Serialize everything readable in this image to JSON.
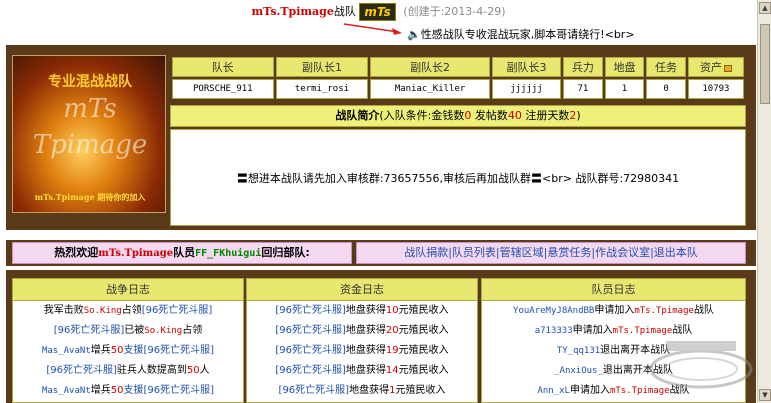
{
  "header": {
    "team_name": "mTs.Tpimage",
    "team_suffix": "战队",
    "logo_text": "mTs",
    "created": "(创建于:2013-4-29)"
  },
  "tagline": {
    "text": "性感战队专收混战玩家,脚本哥请绕行!<br>"
  },
  "crest": {
    "line1": "专业混战战队",
    "line2": "mTs",
    "line3": "Tpimage",
    "line4": "mTs.Tpimage 期待你的加入"
  },
  "officers": {
    "headers": [
      "队长",
      "副队长1",
      "副队长2",
      "副队长3",
      "兵力",
      "地盘",
      "任务",
      "资产"
    ],
    "values": [
      "PORSCHE_911",
      "termi_rosi",
      "Maniac_Killer",
      "jjjjjj",
      "71",
      "1",
      "0",
      "10793"
    ]
  },
  "intro": {
    "title": "战队简介",
    "cond_prefix": "(入队条件:金钱数",
    "gold": "0",
    "posts_label": " 发帖数",
    "posts": "40",
    "days_label": " 注册天数",
    "days": "2",
    "cond_suffix": ")",
    "body": "〓想进本战队请先加入审核群:73657556,审核后再加战队群〓<br> 战队群号:72980341"
  },
  "welcome": {
    "prefix": "热烈欢迎",
    "team": "mTs.Tpimage",
    "mid": "队员",
    "member": "FF_FKhuigui",
    "suffix": "回归部队:"
  },
  "links": [
    "战队捐款",
    "队员列表",
    "管辖区域",
    "悬赏任务",
    "作战会议室",
    "退出本队"
  ],
  "war_log": {
    "title": "战争日志",
    "rows": [
      {
        "a": "我军击败",
        "b": "So.King",
        "c": "占领",
        "d": "[96死亡死斗服]"
      },
      {
        "a": "[96死亡死斗服]",
        "b": "已被",
        "c": "So.King",
        "d": "占领"
      },
      {
        "a": "Mas_AvaNt",
        "b": "增兵",
        "c": "50",
        "d": "支援[96死亡死斗服]"
      },
      {
        "a": "[96死亡死斗服]",
        "b": "驻兵人数提高到",
        "c": "50",
        "d": "人"
      },
      {
        "a": "Mas_AvaNt",
        "b": "增兵",
        "c": "50",
        "d": "支援[96死亡死斗服]"
      }
    ]
  },
  "fund_log": {
    "title": "资金日志",
    "rows": [
      {
        "a": "[96死亡死斗服]",
        "b": "地盘获得",
        "c": "10",
        "d": "元殖民收入"
      },
      {
        "a": "[96死亡死斗服]",
        "b": "地盘获得",
        "c": "20",
        "d": "元殖民收入"
      },
      {
        "a": "[96死亡死斗服]",
        "b": "地盘获得",
        "c": "19",
        "d": "元殖民收入"
      },
      {
        "a": "[96死亡死斗服]",
        "b": "地盘获得",
        "c": "14",
        "d": "元殖民收入"
      },
      {
        "a": "[96死亡死斗服]",
        "b": "地盘获得",
        "c": "1",
        "d": "元殖民收入"
      }
    ]
  },
  "member_log": {
    "title": "队员日志",
    "rows": [
      {
        "a": "YouAreMyJ8AndBB",
        "b": "申请加入",
        "c": "mTs.Tpimage",
        "d": "战队"
      },
      {
        "a": "a713333",
        "b": "申请加入",
        "c": "mTs.Tpimage",
        "d": "战队"
      },
      {
        "a": "TY_qq131",
        "b": "退出离开本战队",
        "c": "",
        "d": ""
      },
      {
        "a": "_AnxiOus_",
        "b": "退出离开本战队",
        "c": "",
        "d": ""
      },
      {
        "a": "Ann_xL",
        "b": "申请加入",
        "c": "mTs.Tpimage",
        "d": "战队"
      }
    ]
  },
  "colors": {
    "panel_brown": "#5a3a18",
    "header_yellow": "#e8e870",
    "accent_red": "#cc0000",
    "link_blue": "#2050b0",
    "member_green": "#008800"
  }
}
